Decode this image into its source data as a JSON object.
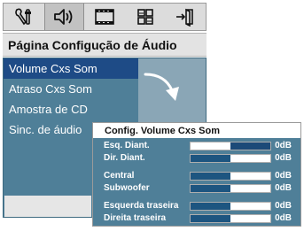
{
  "tabs": [
    {
      "icon": "system-settings-icon",
      "active": false
    },
    {
      "icon": "audio-speaker-icon",
      "active": true
    },
    {
      "icon": "video-film-icon",
      "active": false
    },
    {
      "icon": "preferences-grid-icon",
      "active": false
    },
    {
      "icon": "exit-door-icon",
      "active": false
    }
  ],
  "page_title": "Página Configução de Áudio",
  "menu": {
    "items": [
      {
        "label": "Volume Cxs Som",
        "selected": true
      },
      {
        "label": "Atraso Cxs Som",
        "selected": false
      },
      {
        "label": "Amostra de CD",
        "selected": false
      },
      {
        "label": "Sinc. de áudio",
        "selected": false
      }
    ]
  },
  "speaker_volume": {
    "title": "Config. Volume Cxs Som",
    "rows": [
      {
        "label": "Esq. Diant.",
        "value": "0dB",
        "level": 0.5,
        "fill_from": "right"
      },
      {
        "label": "Dir. Diant.",
        "value": "0dB",
        "level": 0.5,
        "fill_from": "left"
      },
      {
        "label": "Central",
        "value": "0dB",
        "level": 0.5,
        "fill_from": "left"
      },
      {
        "label": "Subwoofer",
        "value": "0dB",
        "level": 0.5,
        "fill_from": "left"
      },
      {
        "label": "Esquerda traseira",
        "value": "0dB",
        "level": 0.5,
        "fill_from": "left"
      },
      {
        "label": "Direita traseira",
        "value": "0dB",
        "level": 0.5,
        "fill_from": "left"
      }
    ]
  },
  "colors": {
    "menu_bg": "#4f7f98",
    "selected_bg": "#1e4b86",
    "bar_fill": "#1d5580"
  }
}
